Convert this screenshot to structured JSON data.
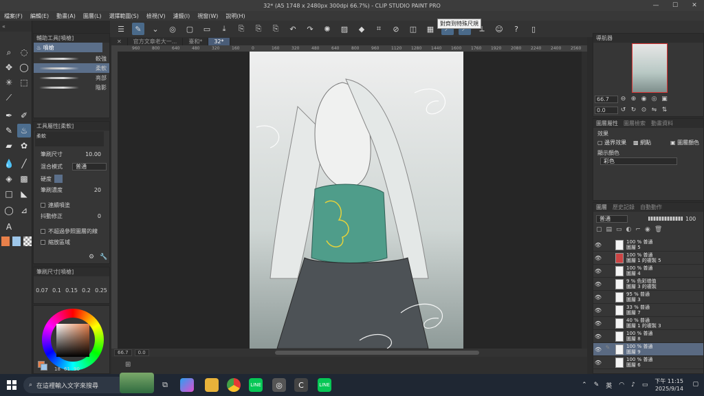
{
  "window": {
    "title": "32* (A5 1748 x 2480px 300dpi 66.7%) - CLIP STUDIO PAINT PRO",
    "minimize": "—",
    "maximize": "☐",
    "close": "✕"
  },
  "menu": [
    "檔案(F)",
    "編輯(E)",
    "動畫(A)",
    "圖層(L)",
    "選擇範圍(S)",
    "檢視(V)",
    "濾鏡(I)",
    "視窗(W)",
    "說明(H)"
  ],
  "toolbar": {
    "tooltip": "對齊到特殊尺規"
  },
  "subtool": {
    "header": "輔助工具[噴槍]",
    "group_tab": "噴槍",
    "brushes": [
      {
        "label": "較強"
      },
      {
        "label": "柔軟"
      },
      {
        "label": "亮部"
      },
      {
        "label": "陰影"
      }
    ]
  },
  "tool_property": {
    "header": "工具屬性[柔軟]",
    "brush_name": "柔軟",
    "brush_size_label": "筆刷尺寸",
    "brush_size_value": "10.00",
    "blend_label": "混合模式",
    "blend_value": "普通",
    "hardness_label": "硬度",
    "density_label": "筆刷濃度",
    "density_value": "20",
    "continuous_label": "連續噴塗",
    "stabilization_label": "抖動修正",
    "stabilization_value": "0",
    "no_ref_label": "不超過參照圖層的線",
    "fill_area_label": "縮放區域"
  },
  "brush_size": {
    "header": "筆刷尺寸[噴槍]",
    "values": [
      "0.07",
      "0.1",
      "0.15",
      "0.2",
      "0.25"
    ]
  },
  "color": {
    "h": "18",
    "s": "61",
    "v": "90",
    "main": "#e8804a",
    "sub": "#9ec7ea"
  },
  "canvas": {
    "tabs": [
      {
        "label": "官方文章老大一..."
      },
      {
        "label": "臺和*"
      },
      {
        "label": "32*",
        "active": true
      }
    ],
    "ruler_h": [
      "960",
      "800",
      "640",
      "480",
      "320",
      "160",
      "0",
      "160",
      "320",
      "480",
      "640",
      "800",
      "960",
      "1120",
      "1280",
      "1440",
      "1600",
      "1760",
      "1920",
      "2080",
      "2240",
      "2400",
      "2560"
    ],
    "zoom": "66.7",
    "rotation": "0.0"
  },
  "navigator": {
    "header": "導航器",
    "zoom": "66.7",
    "rotate": "0.0"
  },
  "layer_property": {
    "tabs": [
      "圖層屬性",
      "圖層檢索",
      "動畫資料"
    ],
    "effect_label": "效果",
    "border_effect": "邊界效果",
    "screentone": "網點",
    "layer_color": "圖層顏色",
    "display_color_label": "顯示顏色",
    "display_color_value": "彩色"
  },
  "layers": {
    "tabs": [
      "圖層",
      "歷史記錄",
      "自動動作"
    ],
    "blend": "普通",
    "opacity": "100",
    "items": [
      {
        "pct": "100 % 普通",
        "name": "圖層 5"
      },
      {
        "pct": "100 % 普通",
        "name": "圖層 1 的複製 5",
        "thumb": "#c44"
      },
      {
        "pct": "100 % 普通",
        "name": "圖層 4"
      },
      {
        "pct": "9 % 色彩增值",
        "name": "圖層 3 的複製"
      },
      {
        "pct": "95 % 普通",
        "name": "圖層 3"
      },
      {
        "pct": "33 % 普通",
        "name": "圖層 7"
      },
      {
        "pct": "40 % 普通",
        "name": "圖層 1 的複製 3"
      },
      {
        "pct": "100 % 普通",
        "name": "圖層 8"
      },
      {
        "pct": "100 % 普通",
        "name": "圖層 9",
        "selected": true
      },
      {
        "pct": "100 % 普通",
        "name": "圖層 6"
      }
    ]
  },
  "taskbar": {
    "search_placeholder": "在這裡輸入文字來搜尋",
    "ime": "英",
    "time": "下午 11:15",
    "date": "2025/9/14"
  }
}
